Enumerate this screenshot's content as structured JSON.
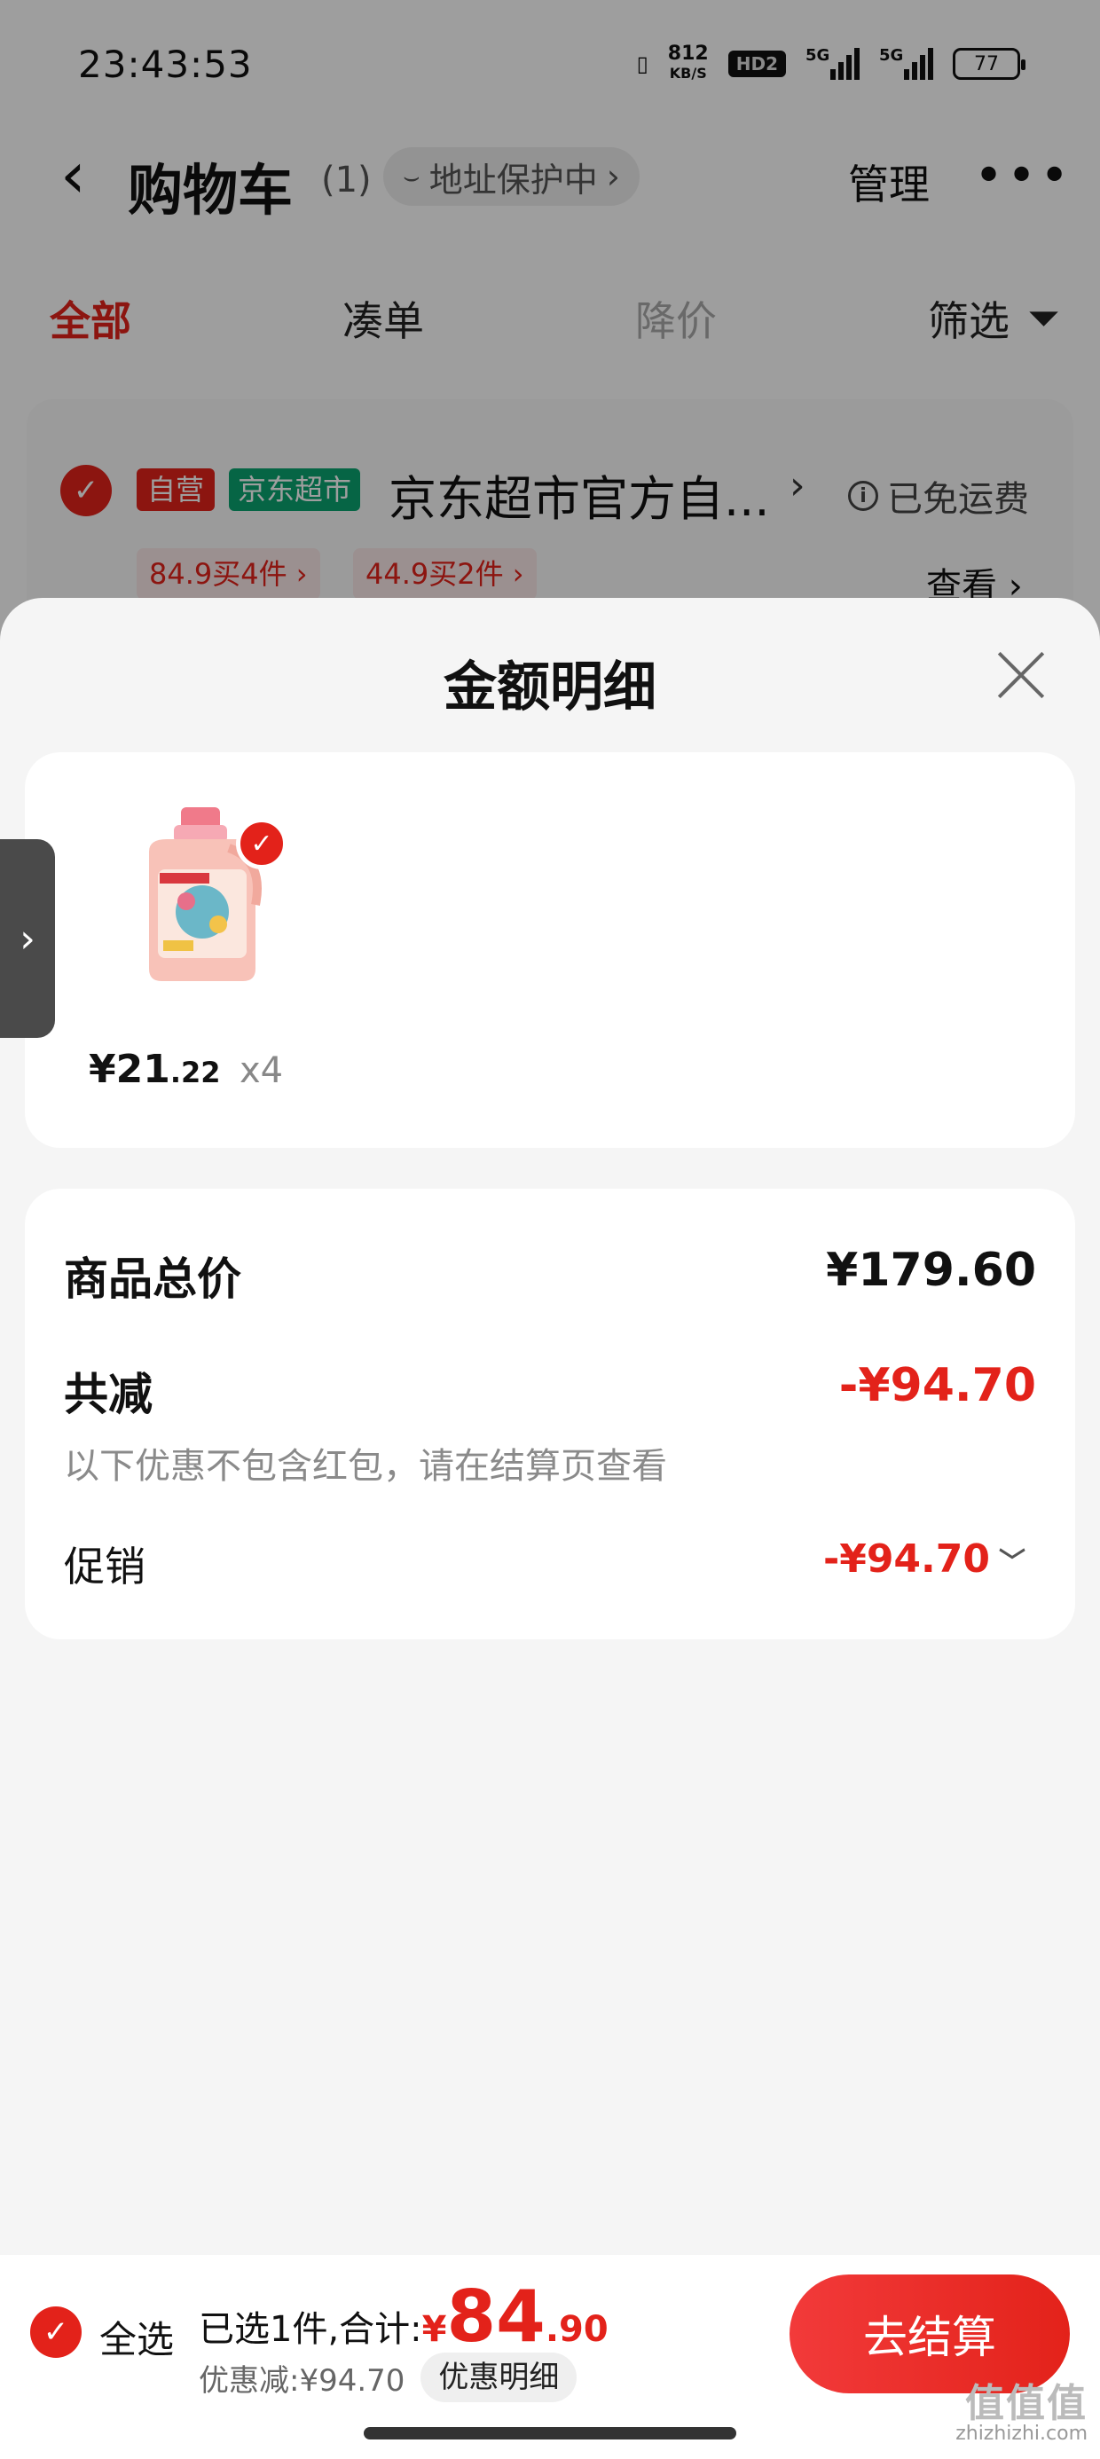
{
  "status_bar": {
    "time": "23:43:53",
    "net_speed": "812",
    "net_unit": "KB/S",
    "hd": "HD2",
    "signal1": "5G",
    "signal2": "5G",
    "battery": "77"
  },
  "header": {
    "title": "购物车",
    "count": "(1)",
    "address_chip": "地址保护中",
    "manage": "管理"
  },
  "tabs": {
    "all": "全部",
    "cou": "凑单",
    "jiang": "降价",
    "filter": "筛选"
  },
  "store": {
    "tag_self": "自营",
    "tag_jd": "京东超市",
    "name": "京东超市官方自...",
    "free_shipping": "已免运费",
    "promo1": "84.9买4件 ›",
    "promo2": "44.9买2件 ›",
    "view": "查看 ›"
  },
  "sheet": {
    "title": "金额明细",
    "item": {
      "price_int": "¥21",
      "price_dec": ".22",
      "qty": "x4"
    },
    "summary": {
      "total_label": "商品总价",
      "total_value": "¥179.60",
      "reduce_label": "共减",
      "reduce_value": "-¥94.70",
      "reduce_note": "以下优惠不包含红包，请在结算页查看",
      "promo_label": "促销",
      "promo_value": "-¥94.70"
    }
  },
  "bottom": {
    "select_all": "全选",
    "selected_text": "已选1件,合计:",
    "currency": "¥",
    "total_int": "84",
    "total_dec": ".90",
    "discount_text": "优惠减:¥94.70",
    "detail_btn": "优惠明细",
    "checkout": "去结算"
  },
  "watermark": {
    "logo": "值值值",
    "site": "zhizhizhi.com"
  },
  "colors": {
    "accent": "#e3221a",
    "jd_green": "#0aa370"
  }
}
